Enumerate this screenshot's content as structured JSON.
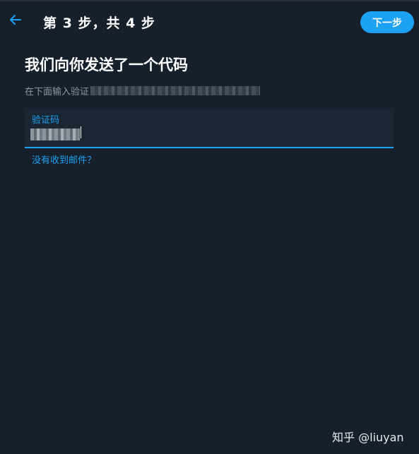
{
  "header": {
    "back_icon": "arrow-left-icon",
    "step_label": "第 3 步，共 4 步",
    "next_label": "下一步"
  },
  "main": {
    "title": "我们向你发送了一个代码",
    "subtitle_prefix": "在下面输入验证"
  },
  "code_field": {
    "label": "验证码"
  },
  "resend": {
    "label": "没有收到邮件？"
  },
  "watermark": {
    "text": "知乎 @liuyan"
  },
  "colors": {
    "background": "#15202b",
    "accent": "#1da1f2",
    "field_bg": "#192734",
    "muted_text": "#8899a6"
  }
}
